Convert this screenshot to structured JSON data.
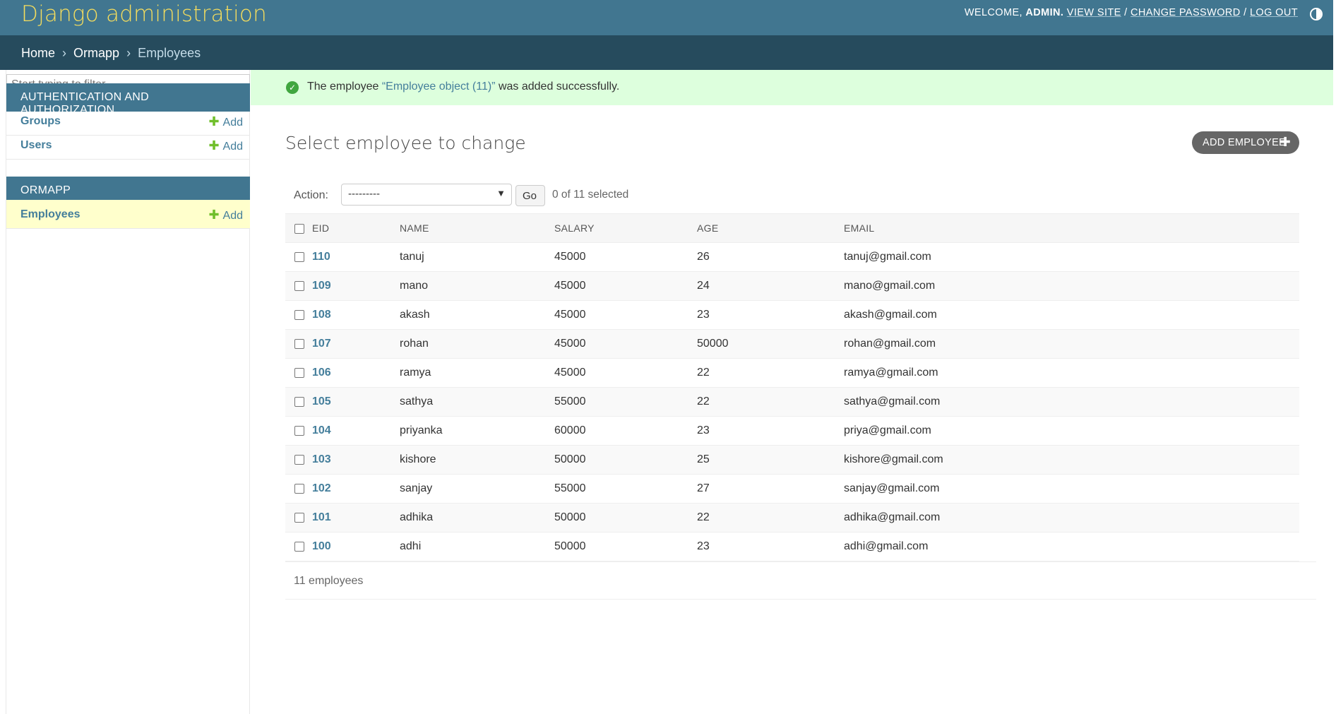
{
  "header": {
    "branding": "Django administration",
    "welcome": "WELCOME,",
    "username": "ADMIN.",
    "view_site": "VIEW SITE",
    "change_password": "CHANGE PASSWORD",
    "log_out": "LOG OUT",
    "sep": "/",
    "theme_icon": "theme-toggle-icon"
  },
  "breadcrumbs": {
    "home": "Home",
    "app": "Ormapp",
    "current": "Employees",
    "sep": "›"
  },
  "sidebar": {
    "filter_placeholder": "Start typing to filter...",
    "modules": [
      {
        "caption": "AUTHENTICATION AND AUTHORIZATION",
        "items": [
          {
            "label": "Groups",
            "add": "Add"
          },
          {
            "label": "Users",
            "add": "Add"
          }
        ]
      },
      {
        "caption": "ORMAPP",
        "items": [
          {
            "label": "Employees",
            "add": "Add"
          }
        ]
      }
    ]
  },
  "message": {
    "prefix": "The employee",
    "link": "“Employee object (11)”",
    "suffix": "was added successfully.",
    "icon": "success-check-icon"
  },
  "content": {
    "title": "Select employee to change",
    "add_button": "ADD EMPLOYEE",
    "action_label": "Action:",
    "action_selected": "---------",
    "go": "Go",
    "counter": "0 of 11 selected",
    "columns": [
      "EID",
      "NAME",
      "SALARY",
      "AGE",
      "EMAIL"
    ],
    "rows": [
      {
        "eid": "110",
        "name": "tanuj",
        "salary": "45000",
        "age": "26",
        "email": "tanuj@gmail.com"
      },
      {
        "eid": "109",
        "name": "mano",
        "salary": "45000",
        "age": "24",
        "email": "mano@gmail.com"
      },
      {
        "eid": "108",
        "name": "akash",
        "salary": "45000",
        "age": "23",
        "email": "akash@gmail.com"
      },
      {
        "eid": "107",
        "name": "rohan",
        "salary": "45000",
        "age": "50000",
        "email": "rohan@gmail.com"
      },
      {
        "eid": "106",
        "name": "ramya",
        "salary": "45000",
        "age": "22",
        "email": "ramya@gmail.com"
      },
      {
        "eid": "105",
        "name": "sathya",
        "salary": "55000",
        "age": "22",
        "email": "sathya@gmail.com"
      },
      {
        "eid": "104",
        "name": "priyanka",
        "salary": "60000",
        "age": "23",
        "email": "priya@gmail.com"
      },
      {
        "eid": "103",
        "name": "kishore",
        "salary": "50000",
        "age": "25",
        "email": "kishore@gmail.com"
      },
      {
        "eid": "102",
        "name": "sanjay",
        "salary": "55000",
        "age": "27",
        "email": "sanjay@gmail.com"
      },
      {
        "eid": "101",
        "name": "adhika",
        "salary": "50000",
        "age": "22",
        "email": "adhika@gmail.com"
      },
      {
        "eid": "100",
        "name": "adhi",
        "salary": "50000",
        "age": "23",
        "email": "adhi@gmail.com"
      }
    ],
    "paginator": "11 employees"
  },
  "colors": {
    "header_bg": "#417690",
    "breadcrumb_bg": "#264b5d",
    "branding": "#f5dd5d",
    "link": "#447e9b",
    "add_green": "#70bf2b",
    "success_bg": "#ddffdd"
  }
}
